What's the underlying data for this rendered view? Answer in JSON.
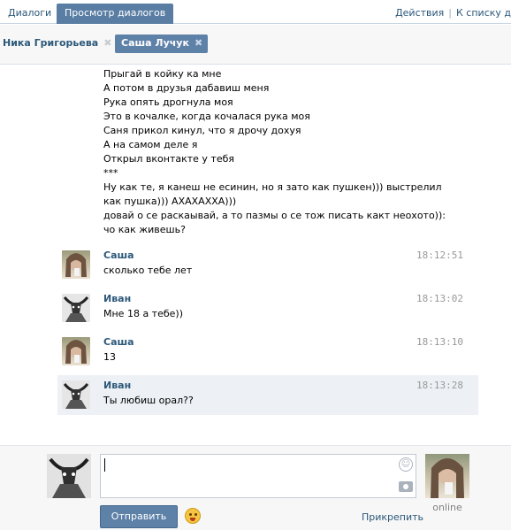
{
  "tabs": {
    "dialogs": "Диалоги",
    "view": "Просмотр диалогов"
  },
  "top_links": {
    "actions": "Действия",
    "separator": "|",
    "to_list": "К списку д"
  },
  "peers": [
    {
      "name": "Ника Григорьева",
      "close": "✖"
    },
    {
      "name": "Саша Лучук",
      "close": "✖"
    }
  ],
  "poem_lines": [
    "Прыгай в койку ка мне",
    "А потом в друзья дабавиш меня",
    "Рука опять дрогнула моя",
    "Это в кочалке, когда кочалася рука моя",
    "Саня прикол кинул, что я дрочу дохуя",
    "А на самом деле я",
    "Открыл вконтакте у тебя",
    "***",
    "Ну как те, я канеш не есинин, но я зато как пушкен))) выстрелил",
    "как пушка))) АХАХАХХА)))",
    "довай о се раскаывай, а то пазмы о се тож писать какт неохото)):",
    "чо как живешь?"
  ],
  "messages": [
    {
      "author": "Саша",
      "time": "18:12:51",
      "text": "сколько тебе лет"
    },
    {
      "author": "Иван",
      "time": "18:13:02",
      "text": "Мне 18 а тебе))"
    },
    {
      "author": "Саша",
      "time": "18:13:10",
      "text": "13"
    },
    {
      "author": "Иван",
      "time": "18:13:28",
      "text": "Ты любиш орал??"
    }
  ],
  "compose": {
    "input_value": "",
    "send_label": "Отправить",
    "attach_label": "Прикрепить",
    "status": "online"
  },
  "colors": {
    "accent": "#5e81a8",
    "link": "#2b587a",
    "highlight": "#edf1f5"
  }
}
